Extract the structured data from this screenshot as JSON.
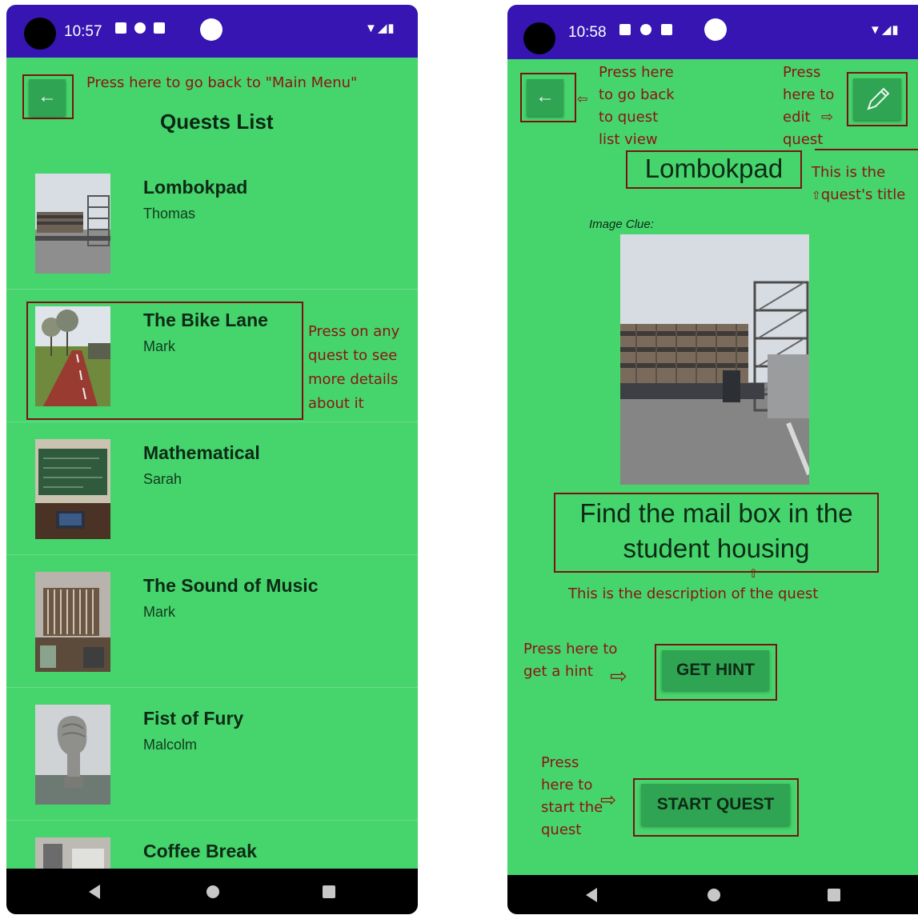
{
  "left_screen": {
    "status": {
      "time": "10:57"
    },
    "title": "Quests List",
    "annotation_back": "Press here to go back to \"Main Menu\"",
    "annotation_quest": [
      "Press on any",
      "quest to see",
      "more details",
      "about it"
    ],
    "quests": [
      {
        "name": "Lombokpad",
        "author": "Thomas",
        "thumb": "building-photo"
      },
      {
        "name": "The Bike Lane",
        "author": "Mark",
        "thumb": "bike-lane-photo"
      },
      {
        "name": "Mathematical",
        "author": "Sarah",
        "thumb": "lecture-hall-photo"
      },
      {
        "name": "The Sound of Music",
        "author": "Mark",
        "thumb": "organ-photo"
      },
      {
        "name": "Fist of Fury",
        "author": "Malcolm",
        "thumb": "statue-photo"
      },
      {
        "name": "Coffee Break",
        "author": "",
        "thumb": "interior-photo"
      }
    ]
  },
  "right_screen": {
    "status": {
      "time": "10:58"
    },
    "title": "Lombokpad",
    "image_clue_label": "Image Clue:",
    "description": [
      "Find the mail box in the",
      "student housing"
    ],
    "hint_button": "GET HINT",
    "start_button": "START QUEST",
    "annotations": {
      "back": [
        "Press here",
        "to go back",
        "to quest",
        "list view"
      ],
      "edit": [
        "Press",
        "here to",
        "edit",
        "quest"
      ],
      "title": [
        "This is the",
        "quest's title"
      ],
      "description": "This is the description of the quest",
      "hint": [
        "Press here to",
        "get a hint"
      ],
      "start": [
        "Press",
        "here to",
        "start the",
        "quest"
      ]
    }
  },
  "colors": {
    "app_background": "#46d46c",
    "status_bar": "#3615b3",
    "button": "#2fa452",
    "annotation": "#8b1414"
  }
}
